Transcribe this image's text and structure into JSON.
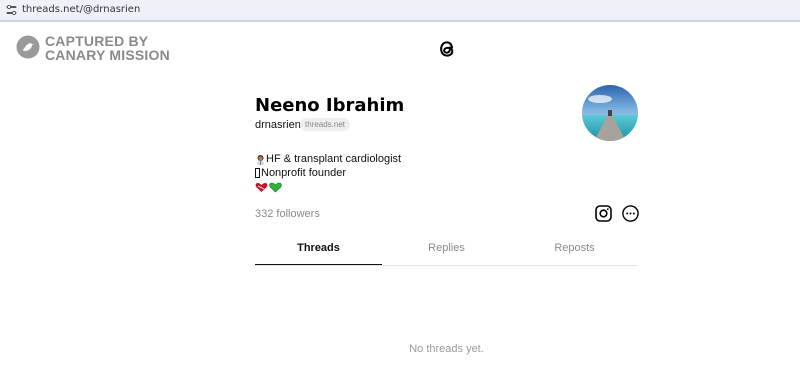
{
  "browser": {
    "url": "threads.net/@drnasrien"
  },
  "watermark": {
    "line1": "CAPTURED BY",
    "line2": "CANARY MISSION"
  },
  "profile": {
    "name": "Neeno Ibrahim",
    "handle": "drnasrien",
    "domain_badge": "threads.net",
    "bio_line1": "HF & transplant cardiologist",
    "bio_line2": "Nonprofit founder",
    "followers": "332 followers"
  },
  "tabs": [
    {
      "label": "Threads",
      "active": true
    },
    {
      "label": "Replies",
      "active": false
    },
    {
      "label": "Reposts",
      "active": false
    }
  ],
  "empty_state": "No threads yet.",
  "icons": {
    "threads_logo": "threads-logo-icon",
    "instagram": "instagram-icon",
    "more": "more-options-icon"
  }
}
